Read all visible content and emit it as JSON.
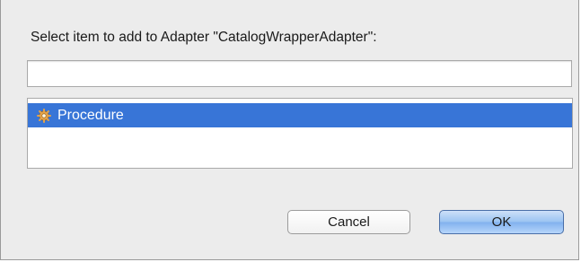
{
  "dialog": {
    "prompt": "Select item to add to Adapter \"CatalogWrapperAdapter\":",
    "filter_value": "",
    "items": [
      {
        "label": "Procedure",
        "icon": "gear-icon",
        "selected": true
      }
    ],
    "buttons": {
      "cancel_label": "Cancel",
      "ok_label": "OK"
    },
    "colors": {
      "selection": "#3875d7",
      "default_button": "#9cc4f2",
      "background": "#ececec"
    }
  }
}
